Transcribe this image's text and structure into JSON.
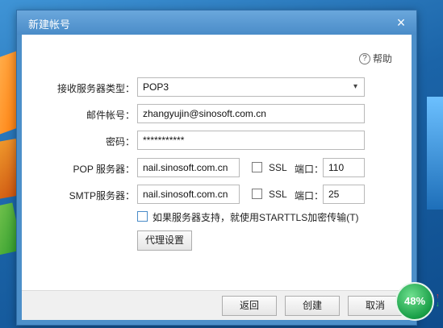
{
  "dialog": {
    "title": "新建帐号",
    "close_icon": "×",
    "help_label": "帮助",
    "help_icon": "?"
  },
  "form": {
    "server_type_label": "接收服务器类型：",
    "server_type_value": "POP3",
    "email_label": "邮件帐号：",
    "email_value": "zhangyujin@sinosoft.com.cn",
    "password_label": "密码：",
    "password_value": "***********",
    "pop_label": "POP 服务器：",
    "pop_value": "nail.sinosoft.com.cn",
    "pop_ssl_label": "SSL",
    "pop_port_label": "端口：",
    "pop_port_value": "110",
    "smtp_label": "SMTP服务器：",
    "smtp_value": "nail.sinosoft.com.cn",
    "smtp_ssl_label": "SSL",
    "smtp_port_label": "端口：",
    "smtp_port_value": "25",
    "starttls_label": "如果服务器支持，就使用STARTTLS加密传输(T)",
    "proxy_button": "代理设置"
  },
  "footer": {
    "back_button": "返回",
    "create_button": "创建",
    "cancel_button": "取消"
  },
  "widget": {
    "percent": "48%",
    "up_arrow": "↑",
    "down_arrow": "↓"
  },
  "colors": {
    "titlebar": "#4a8cc8",
    "gauge": "#189e46"
  }
}
